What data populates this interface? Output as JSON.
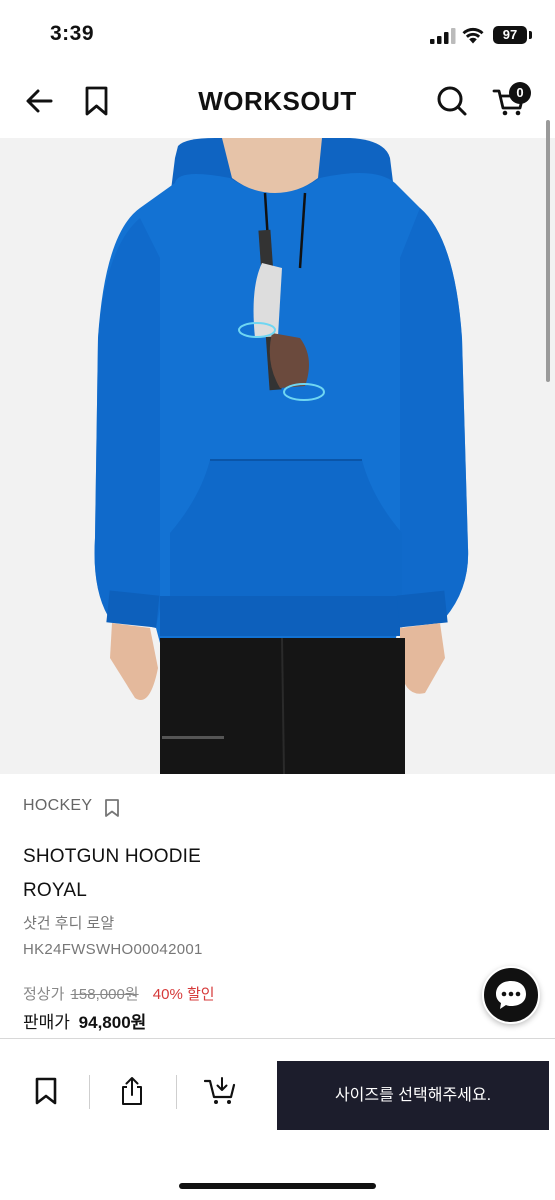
{
  "status_bar": {
    "time": "3:39",
    "battery": "97"
  },
  "header": {
    "brand": "WORKSOUT",
    "cart_count": "0",
    "icons": [
      "back-arrow-icon",
      "bookmark-icon",
      "search-icon",
      "cart-icon"
    ]
  },
  "product": {
    "brand": "HOCKEY",
    "name_line1": "SHOTGUN HOODIE",
    "name_line2": "ROYAL",
    "name_kr": "샷건 후디 로얄",
    "code": "HK24FWSWHO00042001",
    "regular_label": "정상가",
    "regular_price": "158,000원",
    "discount": "40% 할인",
    "sale_label": "판매가",
    "sale_price": "94,800원",
    "hoodie_color": "#1372d3"
  },
  "bottom_bar": {
    "cta": "사이즈를 선택해주세요.",
    "icons": [
      "bookmark-icon",
      "share-icon",
      "add-to-cart-icon"
    ]
  }
}
